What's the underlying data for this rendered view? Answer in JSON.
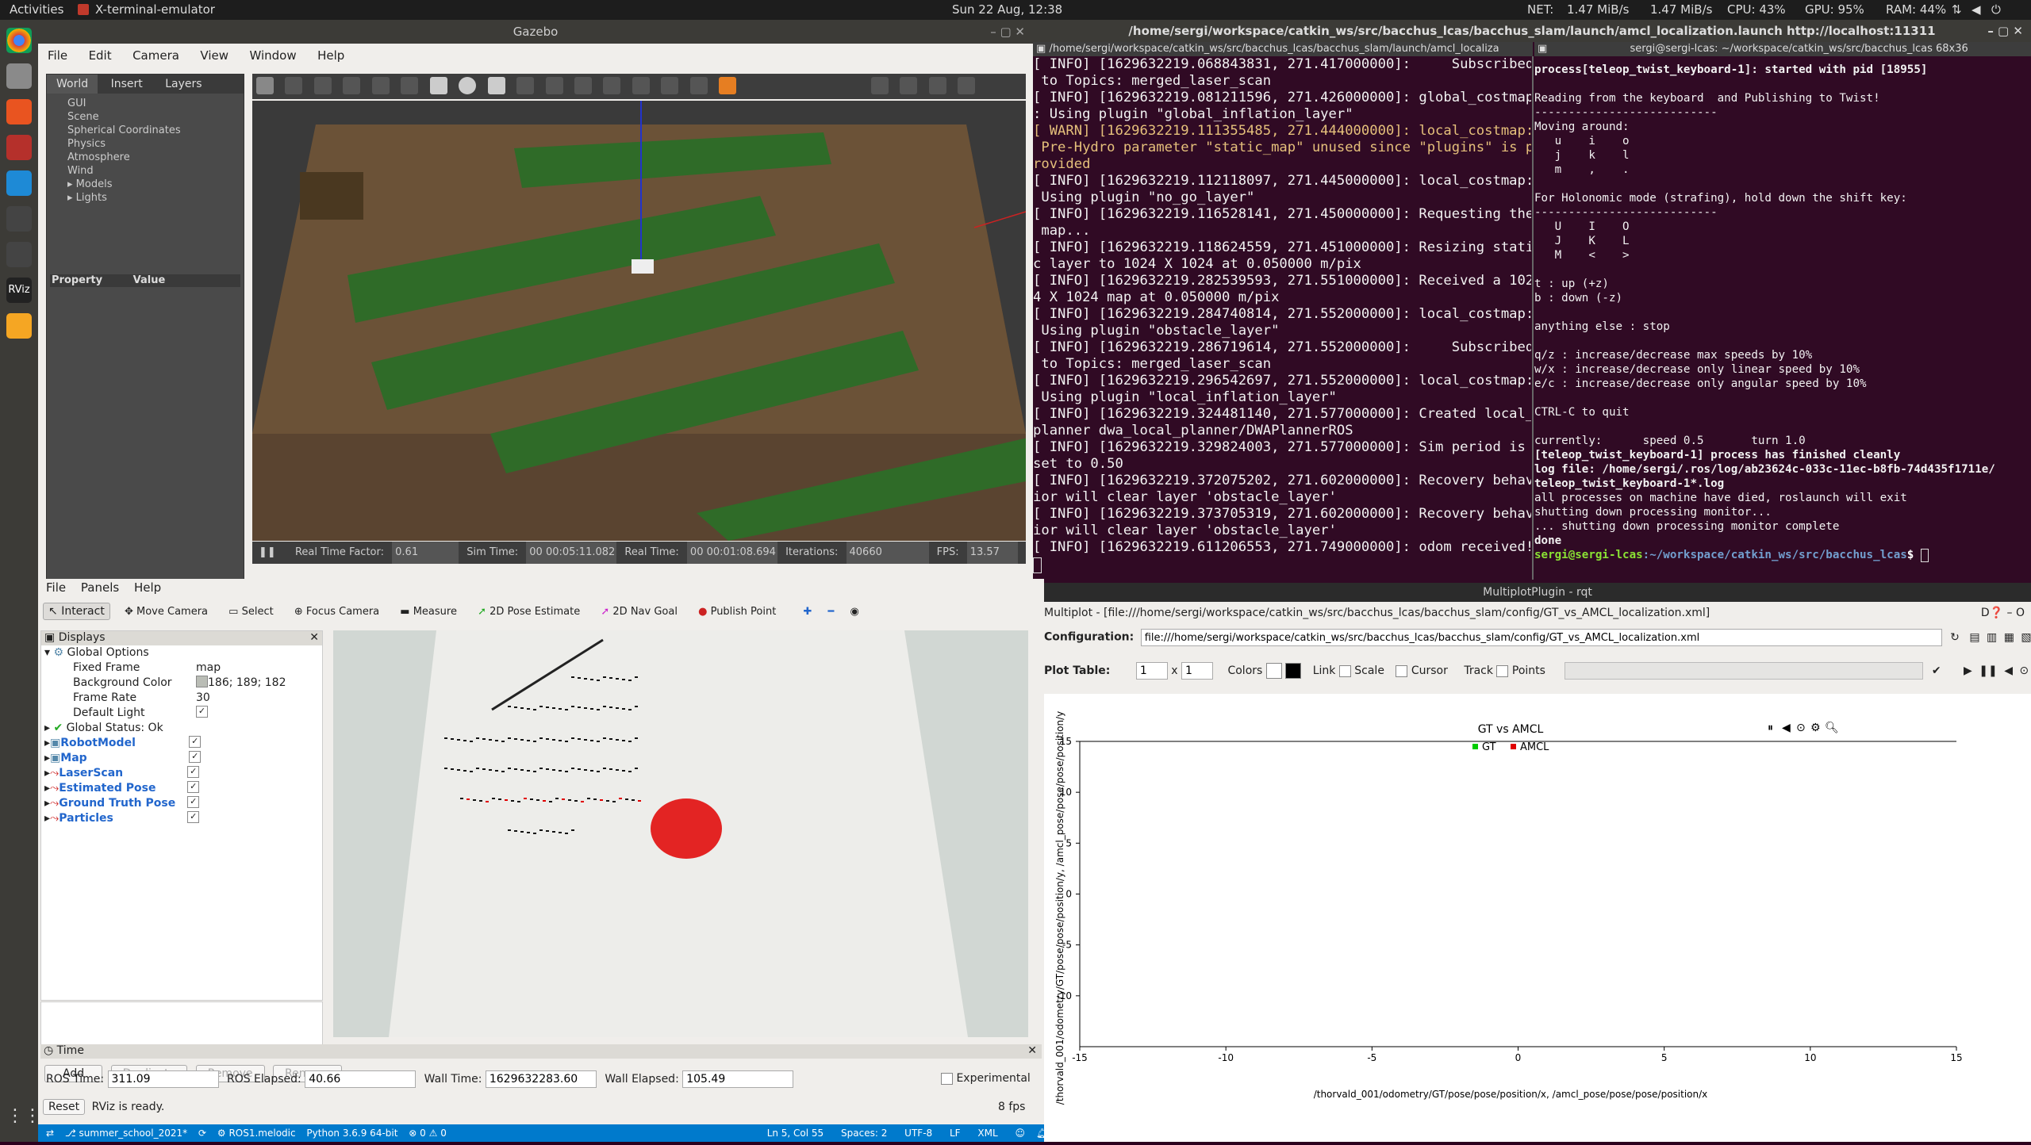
{
  "topbar": {
    "activities": "Activities",
    "app": "X-terminal-emulator",
    "clock": "Sun 22 Aug, 12:38",
    "net": "NET:",
    "net_down": "1.47 MiB/s",
    "net_up": "1.47 MiB/s",
    "cpu": "CPU: 43%",
    "gpu": "GPU: 95%",
    "ram": "RAM: 44%"
  },
  "gazebo": {
    "title": "Gazebo",
    "menu": [
      "File",
      "Edit",
      "Camera",
      "View",
      "Window",
      "Help"
    ],
    "tabs": [
      "World",
      "Insert",
      "Layers"
    ],
    "tree": [
      "GUI",
      "Scene",
      "Spherical Coordinates",
      "Physics",
      "Atmosphere",
      "Wind",
      "Models",
      "Lights"
    ],
    "prop_header": [
      "Property",
      "Value"
    ],
    "status": {
      "rtf_label": "Real Time Factor:",
      "rtf": "0.61",
      "sim_label": "Sim Time:",
      "sim": "00 00:05:11.082",
      "real_label": "Real Time:",
      "real": "00 00:01:08.694",
      "iter_label": "Iterations:",
      "iter": "40660",
      "fps_label": "FPS:",
      "fps": "13.57"
    }
  },
  "term_left": {
    "title": "/home/sergi/workspace/catkin_ws/src/bacchus_lcas/bacchus_slam/launch/amcl_localization.launch http://localhost:11311",
    "tab_left": "/home/sergi/workspace/catkin_ws/src/bacchus_lcas/bacchus_slam/launch/amcl_localiza",
    "tab_right": "sergi@sergi-lcas: ~/workspace/catkin_ws/src/bacchus_lcas 68x36",
    "lines": [
      {
        "t": "[ INFO] [1629632219.068843831, 271.417000000]:     Subscribed",
        "w": false
      },
      {
        "t": " to Topics: merged_laser_scan",
        "w": false
      },
      {
        "t": "[ INFO] [1629632219.081211596, 271.426000000]: global_costmap",
        "w": false
      },
      {
        "t": ": Using plugin \"global_inflation_layer\"",
        "w": false
      },
      {
        "t": "[ WARN] [1629632219.111355485, 271.444000000]: local_costmap:",
        "w": true
      },
      {
        "t": " Pre-Hydro parameter \"static_map\" unused since \"plugins\" is p",
        "w": true
      },
      {
        "t": "rovided",
        "w": true
      },
      {
        "t": "[ INFO] [1629632219.112118097, 271.445000000]: local_costmap:",
        "w": false
      },
      {
        "t": " Using plugin \"no_go_layer\"",
        "w": false
      },
      {
        "t": "[ INFO] [1629632219.116528141, 271.450000000]: Requesting the",
        "w": false
      },
      {
        "t": " map...",
        "w": false
      },
      {
        "t": "[ INFO] [1629632219.118624559, 271.451000000]: Resizing stati",
        "w": false
      },
      {
        "t": "c layer to 1024 X 1024 at 0.050000 m/pix",
        "w": false
      },
      {
        "t": "[ INFO] [1629632219.282539593, 271.551000000]: Received a 102",
        "w": false
      },
      {
        "t": "4 X 1024 map at 0.050000 m/pix",
        "w": false
      },
      {
        "t": "[ INFO] [1629632219.284740814, 271.552000000]: local_costmap:",
        "w": false
      },
      {
        "t": " Using plugin \"obstacle_layer\"",
        "w": false
      },
      {
        "t": "[ INFO] [1629632219.286719614, 271.552000000]:     Subscribed",
        "w": false
      },
      {
        "t": " to Topics: merged_laser_scan",
        "w": false
      },
      {
        "t": "[ INFO] [1629632219.296542697, 271.552000000]: local_costmap:",
        "w": false
      },
      {
        "t": " Using plugin \"local_inflation_layer\"",
        "w": false
      },
      {
        "t": "[ INFO] [1629632219.324481140, 271.577000000]: Created local_",
        "w": false
      },
      {
        "t": "planner dwa_local_planner/DWAPlannerROS",
        "w": false
      },
      {
        "t": "[ INFO] [1629632219.329824003, 271.577000000]: Sim period is",
        "w": false
      },
      {
        "t": "set to 0.50",
        "w": false
      },
      {
        "t": "[ INFO] [1629632219.372075202, 271.602000000]: Recovery behav",
        "w": false
      },
      {
        "t": "ior will clear layer 'obstacle_layer'",
        "w": false
      },
      {
        "t": "[ INFO] [1629632219.373705319, 271.602000000]: Recovery behav",
        "w": false
      },
      {
        "t": "ior will clear layer 'obstacle_layer'",
        "w": false
      },
      {
        "t": "[ INFO] [1629632219.611206553, 271.749000000]: odom received!",
        "w": false
      }
    ]
  },
  "term_right": {
    "lines": [
      {
        "t": "process[teleop_twist_keyboard-1]: started with pid [18955]",
        "b": true
      },
      {
        "t": "",
        "b": false
      },
      {
        "t": "Reading from the keyboard  and Publishing to Twist!",
        "b": false
      },
      {
        "t": "---------------------------",
        "b": false
      },
      {
        "t": "Moving around:",
        "b": false
      },
      {
        "t": "   u    i    o",
        "b": false
      },
      {
        "t": "   j    k    l",
        "b": false
      },
      {
        "t": "   m    ,    .",
        "b": false
      },
      {
        "t": "",
        "b": false
      },
      {
        "t": "For Holonomic mode (strafing), hold down the shift key:",
        "b": false
      },
      {
        "t": "---------------------------",
        "b": false
      },
      {
        "t": "   U    I    O",
        "b": false
      },
      {
        "t": "   J    K    L",
        "b": false
      },
      {
        "t": "   M    <    >",
        "b": false
      },
      {
        "t": "",
        "b": false
      },
      {
        "t": "t : up (+z)",
        "b": false
      },
      {
        "t": "b : down (-z)",
        "b": false
      },
      {
        "t": "",
        "b": false
      },
      {
        "t": "anything else : stop",
        "b": false
      },
      {
        "t": "",
        "b": false
      },
      {
        "t": "q/z : increase/decrease max speeds by 10%",
        "b": false
      },
      {
        "t": "w/x : increase/decrease only linear speed by 10%",
        "b": false
      },
      {
        "t": "e/c : increase/decrease only angular speed by 10%",
        "b": false
      },
      {
        "t": "",
        "b": false
      },
      {
        "t": "CTRL-C to quit",
        "b": false
      },
      {
        "t": "",
        "b": false
      },
      {
        "t": "currently:      speed 0.5       turn 1.0",
        "b": false
      },
      {
        "t": "[teleop_twist_keyboard-1] process has finished cleanly",
        "b": true
      },
      {
        "t": "log file: /home/sergi/.ros/log/ab23624c-033c-11ec-b8fb-74d435f1711e/",
        "b": true
      },
      {
        "t": "teleop_twist_keyboard-1*.log",
        "b": true
      },
      {
        "t": "all processes on machine have died, roslaunch will exit",
        "b": false
      },
      {
        "t": "shutting down processing monitor...",
        "b": false
      },
      {
        "t": "... shutting down processing monitor complete",
        "b": false
      },
      {
        "t": "done",
        "b": true
      }
    ],
    "prompt_user": "sergi@sergi-lcas",
    "prompt_path": ":~/workspace/catkin_ws/src/bacchus_lcas",
    "prompt_end": "$ "
  },
  "rviz": {
    "menu": [
      "File",
      "Panels",
      "Help"
    ],
    "tools": [
      "Interact",
      "Move Camera",
      "Select",
      "Focus Camera",
      "Measure",
      "2D Pose Estimate",
      "2D Nav Goal",
      "Publish Point"
    ],
    "displays_title": "Displays",
    "global_options": "Global Options",
    "options": [
      {
        "k": "Fixed Frame",
        "v": "map"
      },
      {
        "k": "Background Color",
        "v": "186; 189; 182"
      },
      {
        "k": "Frame Rate",
        "v": "30"
      },
      {
        "k": "Default Light",
        "v": ""
      }
    ],
    "global_status": "Global Status: Ok",
    "displays": [
      "RobotModel",
      "Map",
      "LaserScan",
      "Estimated Pose",
      "Ground Truth Pose",
      "Particles"
    ],
    "buttons": [
      "Add",
      "Duplicate",
      "Remove",
      "Rename"
    ],
    "time_title": "Time",
    "ros_time_label": "ROS Time:",
    "ros_time": "311.09",
    "ros_elapsed_label": "ROS Elapsed:",
    "ros_elapsed": "40.66",
    "wall_time_label": "Wall Time:",
    "wall_time": "1629632283.60",
    "wall_elapsed_label": "Wall Elapsed:",
    "wall_elapsed": "105.49",
    "experimental": "Experimental",
    "reset": "Reset",
    "status": "RViz is ready.",
    "fps": "8 fps"
  },
  "vscode_status": {
    "branch": "summer_school_2021*",
    "ros": "ROS1.melodic",
    "python": "Python 3.6.9 64-bit",
    "errors": "0",
    "warnings": "0",
    "position": "Ln 5, Col 55",
    "spaces": "Spaces: 2",
    "encoding": "UTF-8",
    "eol": "LF",
    "lang": "XML"
  },
  "rqt": {
    "title": "MultiplotPlugin - rqt",
    "header": "Multiplot - [file:///home/sergi/workspace/catkin_ws/src/bacchus_lcas/bacchus_slam/config/GT_vs_AMCL_localization.xml]",
    "config_label": "Configuration:",
    "config_value": "file:///home/sergi/workspace/catkin_ws/src/bacchus_lcas/bacchus_slam/config/GT_vs_AMCL_localization.xml",
    "plot_table_label": "Plot Table:",
    "rows": "1",
    "cols": "1",
    "x": "x",
    "options": [
      "Colors",
      "Link",
      "Scale",
      "Cursor",
      "Track",
      "Points"
    ]
  },
  "chart_data": {
    "type": "scatter",
    "title": "GT vs AMCL",
    "series": [
      {
        "name": "GT",
        "color": "#00cc00",
        "points": []
      },
      {
        "name": "AMCL",
        "color": "#e00000",
        "points": []
      }
    ],
    "xlabel": "/thorvald_001/odometry/GT/pose/pose/position/x, /amcl_pose/pose/pose/position/x",
    "ylabel": "/thorvald_001/odometry/GT/pose/pose/position/y, /amcl_pose/pose/pose/position/y",
    "xlim": [
      -15,
      15
    ],
    "ylim": [
      -15,
      15
    ],
    "xticks": [
      -15,
      -10,
      -5,
      0,
      5,
      10,
      15
    ],
    "yticks": [
      15,
      10,
      5,
      0,
      -5,
      -10
    ],
    "legend": "top-center"
  }
}
